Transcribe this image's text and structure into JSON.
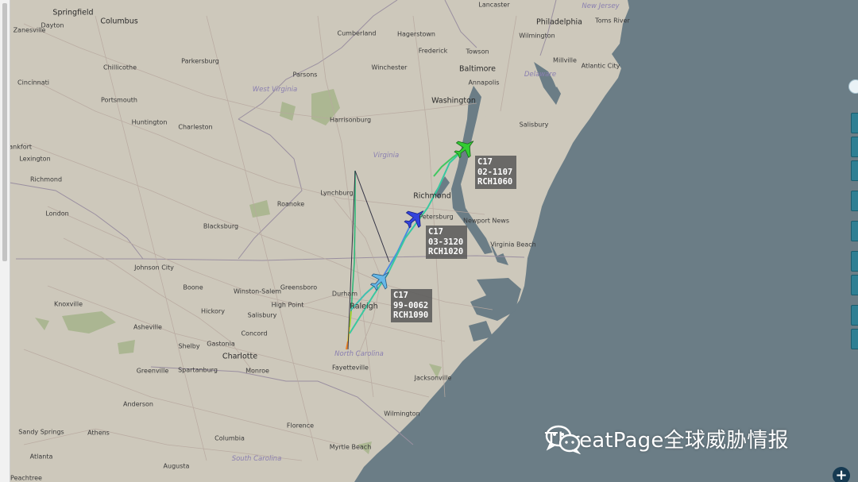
{
  "map": {
    "cities": [
      {
        "name": "Springfield",
        "c": "big"
      },
      {
        "name": "Columbus",
        "c": "big"
      },
      {
        "name": "Dayton"
      },
      {
        "name": "Zanesville"
      },
      {
        "name": "Cumberland"
      },
      {
        "name": "Hagerstown"
      },
      {
        "name": "Lancaster"
      },
      {
        "name": "Philadelphia",
        "c": "big"
      },
      {
        "name": "New Jersey",
        "c": "state"
      },
      {
        "name": "Toms River"
      },
      {
        "name": "Wilmington"
      },
      {
        "name": "Frederick"
      },
      {
        "name": "Towson"
      },
      {
        "name": "Baltimore",
        "c": "big"
      },
      {
        "name": "Millville"
      },
      {
        "name": "Atlantic City"
      },
      {
        "name": "Parkersburg"
      },
      {
        "name": "Chillicothe"
      },
      {
        "name": "Parsons"
      },
      {
        "name": "Winchester"
      },
      {
        "name": "Annapolis"
      },
      {
        "name": "Delaware",
        "c": "state"
      },
      {
        "name": "Cincinnati"
      },
      {
        "name": "West Virginia",
        "c": "state"
      },
      {
        "name": "Washington",
        "c": "big"
      },
      {
        "name": "Portsmouth"
      },
      {
        "name": "Huntington"
      },
      {
        "name": "Charleston"
      },
      {
        "name": "Harrisonburg"
      },
      {
        "name": "Salisbury"
      },
      {
        "name": "Frankfort"
      },
      {
        "name": "Lexington"
      },
      {
        "name": "Virginia",
        "c": "state"
      },
      {
        "name": "Richmond"
      },
      {
        "name": "Lynchburg"
      },
      {
        "name": "Richmond",
        "c": "big"
      },
      {
        "name": "Roanoke"
      },
      {
        "name": "London"
      },
      {
        "name": "Blacksburg"
      },
      {
        "name": "Petersburg"
      },
      {
        "name": "Newport News"
      },
      {
        "name": "Virginia Beach"
      },
      {
        "name": "Johnson City"
      },
      {
        "name": "Boone"
      },
      {
        "name": "Winston-Salem"
      },
      {
        "name": "Greensboro"
      },
      {
        "name": "Knoxville"
      },
      {
        "name": "High Point"
      },
      {
        "name": "Durham"
      },
      {
        "name": "Hickory"
      },
      {
        "name": "Salisbury"
      },
      {
        "name": "Asheville"
      },
      {
        "name": "Shelby"
      },
      {
        "name": "Gastonia"
      },
      {
        "name": "Concord"
      },
      {
        "name": "Charlotte",
        "c": "big"
      },
      {
        "name": "North Carolina",
        "c": "state"
      },
      {
        "name": "Fayetteville"
      },
      {
        "name": "Greenville"
      },
      {
        "name": "Spartanburg"
      },
      {
        "name": "Monroe"
      },
      {
        "name": "Jacksonville"
      },
      {
        "name": "Anderson"
      },
      {
        "name": "Wilmington"
      },
      {
        "name": "Sandy Springs"
      },
      {
        "name": "Athens"
      },
      {
        "name": "Florence"
      },
      {
        "name": "Columbia"
      },
      {
        "name": "Myrtle Beach"
      },
      {
        "name": "Atlanta"
      },
      {
        "name": "Augusta"
      },
      {
        "name": "South Carolina",
        "c": "state"
      },
      {
        "name": "Peachtree"
      },
      {
        "name": "Raleigh",
        "c": "big"
      }
    ]
  },
  "flights": [
    {
      "type": "C17",
      "reg": "02-1107",
      "callsign": "RCH1060",
      "color": "#33cc33"
    },
    {
      "type": "C17",
      "reg": "03-3120",
      "callsign": "RCH1020",
      "color": "#3344dd"
    },
    {
      "type": "C17",
      "reg": "99-0062",
      "callsign": "RCH1090",
      "color": "#55aadd"
    }
  ],
  "watermark": {
    "text": "ThreatPage全球威胁情报",
    "icon": "wechat-icon"
  },
  "controls": {
    "zoom_in": "+",
    "gear": "gear-icon"
  },
  "colors": {
    "sea": "#6b7d86",
    "land": "#cdc8bb",
    "park": "#a8b58e"
  }
}
